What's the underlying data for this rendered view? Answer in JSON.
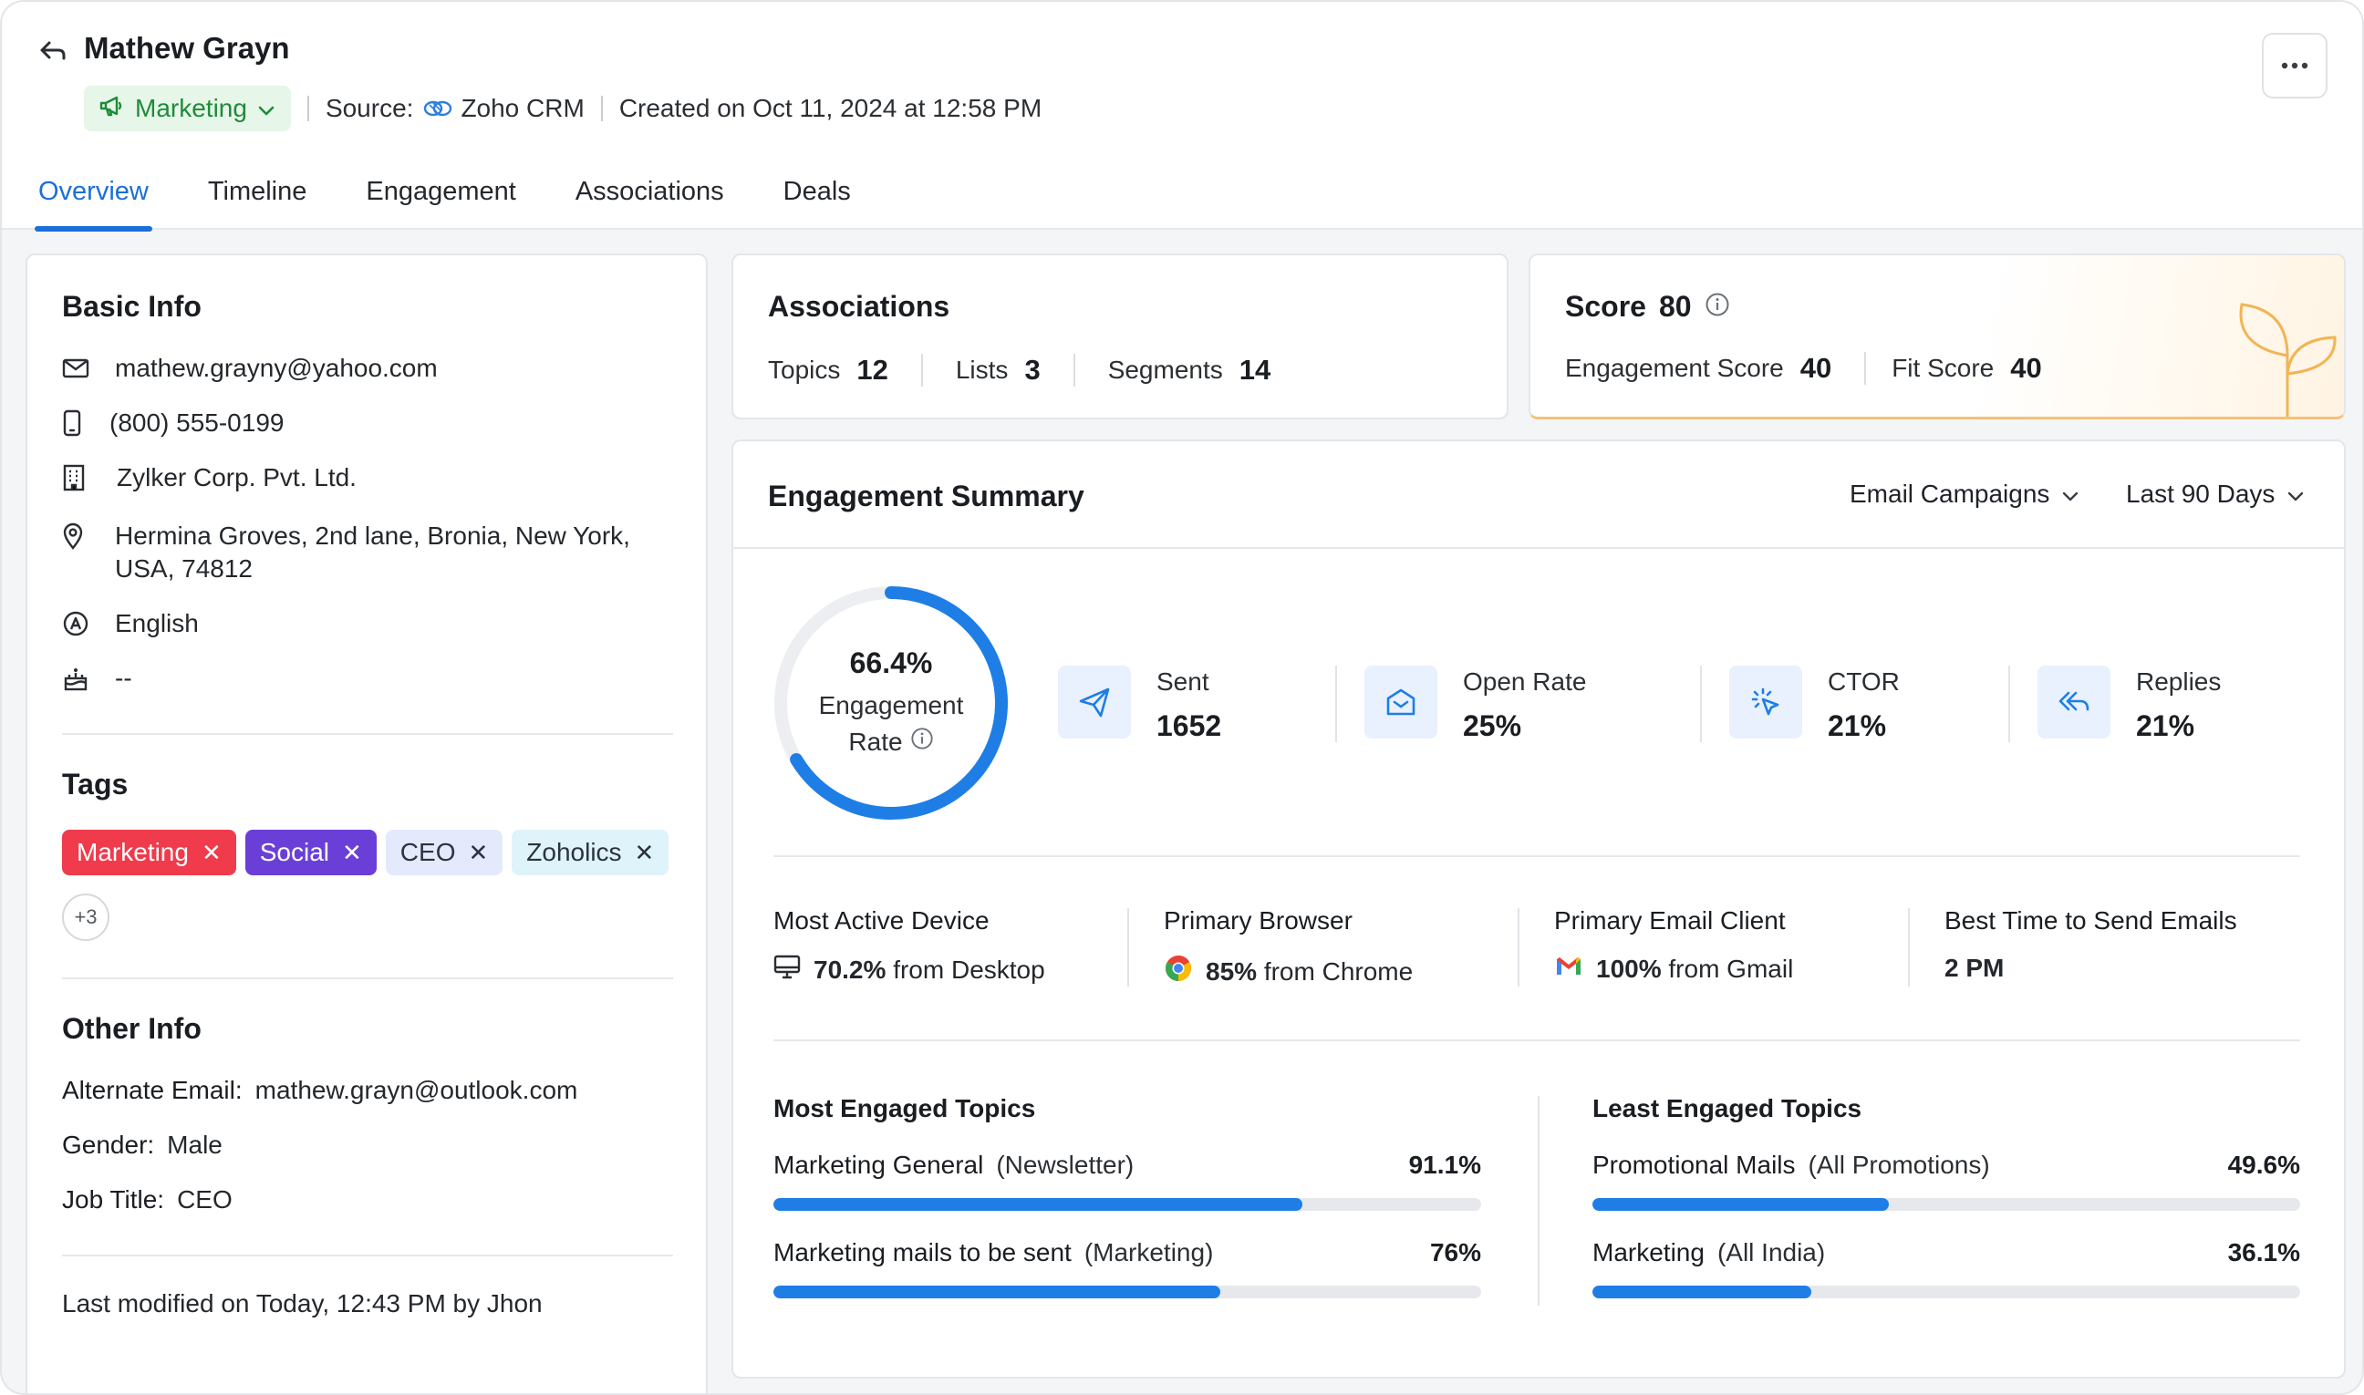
{
  "header": {
    "name": "Mathew Grayn",
    "type_label": "Marketing",
    "source_label": "Source:",
    "source_value": "Zoho CRM",
    "created": "Created on Oct 11, 2024 at 12:58 PM"
  },
  "tabs": [
    {
      "label": "Overview",
      "active": true
    },
    {
      "label": "Timeline"
    },
    {
      "label": "Engagement"
    },
    {
      "label": "Associations"
    },
    {
      "label": "Deals"
    }
  ],
  "basic_info": {
    "title": "Basic Info",
    "email": "mathew.grayny@yahoo.com",
    "phone": "(800) 555-0199",
    "company": "Zylker Corp. Pvt. Ltd.",
    "address_line1": "Hermina Groves, 2nd lane, Bronia, New York,",
    "address_line2": "USA, 74812",
    "language": "English",
    "birthday": "--"
  },
  "tags": {
    "title": "Tags",
    "items": [
      {
        "label": "Marketing",
        "bg": "#ef3b4c",
        "color": "#ffffff"
      },
      {
        "label": "Social",
        "bg": "#6a3fd8",
        "color": "#ffffff"
      },
      {
        "label": "CEO",
        "bg": "#e4eafb",
        "color": "#2b3340"
      },
      {
        "label": "Zoholics",
        "bg": "#dff3fb",
        "color": "#2b3340"
      }
    ],
    "more": "+3"
  },
  "other_info": {
    "title": "Other Info",
    "alt_email_key": "Alternate Email:",
    "alt_email": "mathew.grayn@outlook.com",
    "gender_key": "Gender:",
    "gender": "Male",
    "job_key": "Job Title:",
    "job": "CEO",
    "last_modified": "Last modified on Today, 12:43 PM by Jhon"
  },
  "associations": {
    "title": "Associations",
    "topics_label": "Topics",
    "topics": "12",
    "lists_label": "Lists",
    "lists": "3",
    "segments_label": "Segments",
    "segments": "14"
  },
  "score": {
    "title": "Score",
    "value": "80",
    "engagement_label": "Engagement Score",
    "engagement": "40",
    "fit_label": "Fit Score",
    "fit": "40"
  },
  "engagement": {
    "title": "Engagement Summary",
    "filter_campaign": "Email Campaigns",
    "filter_period": "Last 90 Days",
    "rate_value": "66.4%",
    "rate_pct": 66.4,
    "rate_label1": "Engagement",
    "rate_label2": "Rate",
    "stats": [
      {
        "label": "Sent",
        "value": "1652",
        "icon": "send-icon"
      },
      {
        "label": "Open Rate",
        "value": "25%",
        "icon": "open-mail-icon"
      },
      {
        "label": "CTOR",
        "value": "21%",
        "icon": "click-icon"
      },
      {
        "label": "Replies",
        "value": "21%",
        "icon": "reply-all-icon"
      }
    ],
    "device_title": "Most Active Device",
    "device_pct": "70.2%",
    "device_rest": "from Desktop",
    "browser_title": "Primary Browser",
    "browser_pct": "85%",
    "browser_rest": "from Chrome",
    "client_title": "Primary Email Client",
    "client_pct": "100%",
    "client_rest": "from Gmail",
    "time_title": "Best Time to Send Emails",
    "time_value": "2 PM",
    "most_title": "Most Engaged Topics",
    "most": [
      {
        "name": "Marketing General",
        "sub": "(Newsletter)",
        "pct": "91.1%",
        "fill": 0.747
      },
      {
        "name": "Marketing mails to be sent",
        "sub": "(Marketing)",
        "pct": "76%",
        "fill": 0.632
      }
    ],
    "least_title": "Least Engaged Topics",
    "least": [
      {
        "name": "Promotional Mails",
        "sub": "(All Promotions)",
        "pct": "49.6%",
        "fill": 0.419
      },
      {
        "name": "Marketing",
        "sub": "(All India)",
        "pct": "36.1%",
        "fill": 0.309
      }
    ]
  },
  "colors": {
    "accent": "#1b6fd8",
    "bar": "#1e7ee6",
    "ring_track": "#eceef1"
  }
}
